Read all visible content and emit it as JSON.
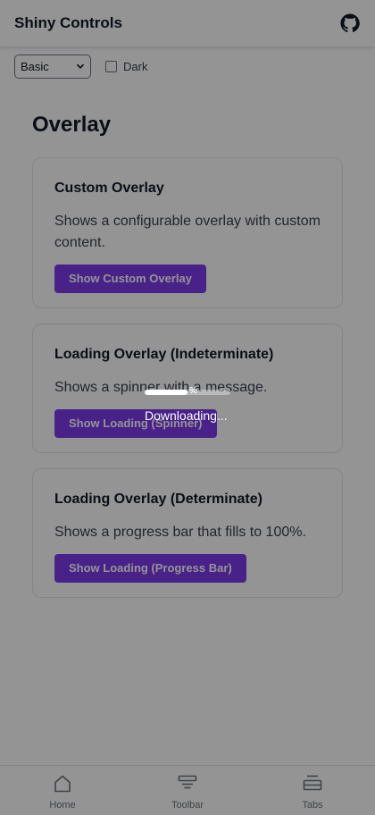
{
  "header": {
    "title": "Shiny Controls",
    "github_icon": "github-icon"
  },
  "controls": {
    "theme_select_value": "Basic",
    "dark_label": "Dark",
    "dark_checked": false
  },
  "section": {
    "title": "Overlay"
  },
  "cards": [
    {
      "title": "Custom Overlay",
      "description": "Shows a configurable overlay with custom content.",
      "button": "Show Custom Overlay"
    },
    {
      "title": "Loading Overlay (Indeterminate)",
      "description": "Shows a spinner with a message.",
      "button": "Show Loading (Spinner)"
    },
    {
      "title": "Loading Overlay (Determinate)",
      "description": "Shows a progress bar that fills to 100%.",
      "button": "Show Loading (Progress Bar)"
    }
  ],
  "tabs": [
    {
      "label": "Home",
      "icon": "home-icon"
    },
    {
      "label": "Toolbar",
      "icon": "toolbar-icon"
    },
    {
      "label": "Tabs",
      "icon": "tabs-icon"
    }
  ],
  "overlay": {
    "message": "Downloading...",
    "progress_text": "%",
    "progress_fraction": 0.5,
    "scrim_color": "#000000"
  },
  "colors": {
    "accent": "#7c3aed",
    "text": "#111827",
    "muted": "#6b7280"
  }
}
